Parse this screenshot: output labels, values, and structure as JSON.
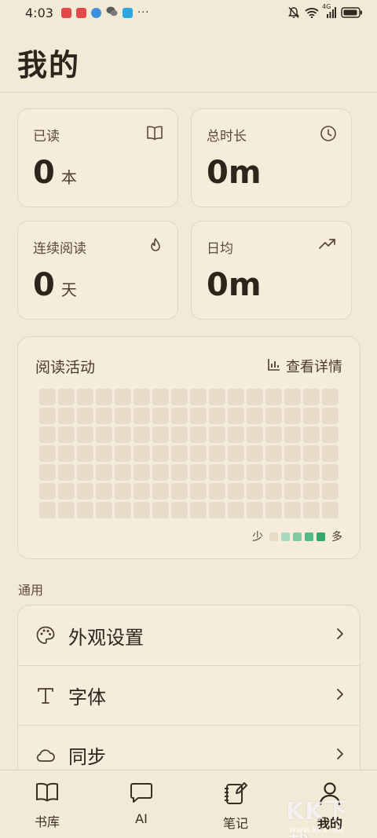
{
  "status_bar": {
    "time": "4:03",
    "more": "···",
    "app_colors": [
      "#e54848",
      "#e54848",
      "#3d8fe0",
      "#5a5a5a",
      "#2aa6e0"
    ],
    "network": "4G"
  },
  "page": {
    "title": "我的"
  },
  "stats": [
    {
      "label": "已读",
      "value": "0",
      "unit": "本",
      "icon": "book-icon"
    },
    {
      "label": "总时长",
      "value": "0m",
      "unit": "",
      "icon": "clock-icon"
    },
    {
      "label": "连续阅读",
      "value": "0",
      "unit": "天",
      "icon": "flame-icon"
    },
    {
      "label": "日均",
      "value": "0m",
      "unit": "",
      "icon": "trend-up-icon"
    }
  ],
  "activity": {
    "title": "阅读活动",
    "detail_label": "查看详情",
    "rows": 7,
    "cols": 16,
    "legend_less": "少",
    "legend_more": "多",
    "legend_colors": [
      "#e7dcc8",
      "#a9d9bd",
      "#7fcca3",
      "#52ba86",
      "#2ea86c"
    ]
  },
  "settings": {
    "section_label": "通用",
    "items": [
      {
        "label": "外观设置",
        "icon": "palette-icon"
      },
      {
        "label": "字体",
        "icon": "font-icon"
      },
      {
        "label": "同步",
        "icon": "cloud-icon"
      }
    ]
  },
  "tabs": [
    {
      "label": "书库",
      "icon": "library-icon",
      "active": false
    },
    {
      "label": "AI",
      "icon": "chat-icon",
      "active": false
    },
    {
      "label": "笔记",
      "icon": "notes-icon",
      "active": false
    },
    {
      "label": "我的",
      "icon": "profile-icon",
      "active": true
    }
  ],
  "colors": {
    "background": "#f3e9d7",
    "card": "#f6ecdb",
    "text": "#2f241b",
    "heat_empty": "#e7dcc8"
  },
  "watermark": {
    "brand": "KK下载",
    "site": "www.kkx.net"
  }
}
